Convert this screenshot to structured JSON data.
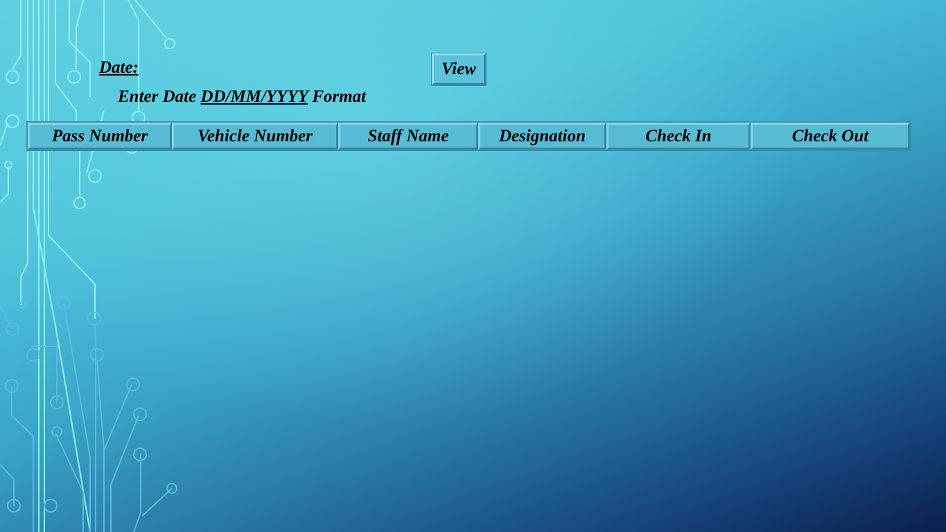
{
  "form": {
    "date_label": "Date:",
    "hint_prefix": "Enter Date ",
    "hint_format": "DD/MM/YYYY",
    "hint_suffix": " Format",
    "view_label": "View"
  },
  "table": {
    "columns": [
      "Pass Number",
      "Vehicle Number",
      "Staff Name",
      "Designation",
      "Check In",
      "Check Out"
    ]
  },
  "icons": [
    "circuit-decoration"
  ],
  "colors": {
    "background_light": "#5fd0e0",
    "background_dark": "#0a1f4f",
    "header_cell": "#57bbd4",
    "text": "#000000"
  }
}
